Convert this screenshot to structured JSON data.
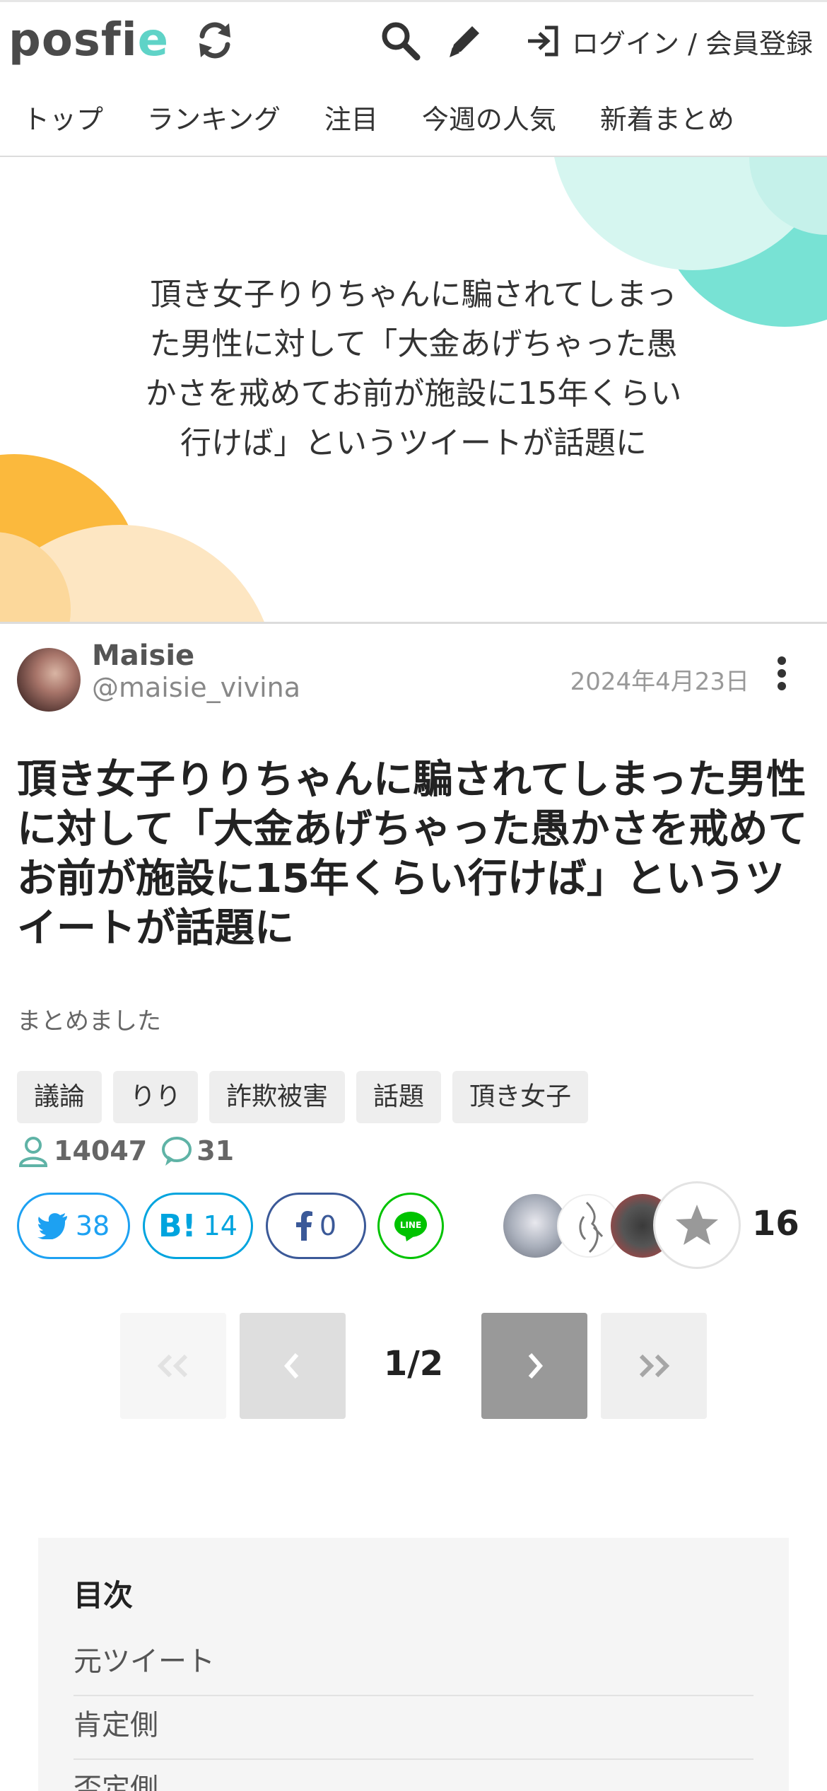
{
  "header": {
    "logo_main": "posfi",
    "logo_accent": "e",
    "login_label": "ログイン / 会員登録"
  },
  "nav": {
    "items": [
      "トップ",
      "ランキング",
      "注目",
      "今週の人気",
      "新着まとめ"
    ]
  },
  "hero": {
    "title": "頂き女子りりちゃんに騙されてしまった男性に対して「大金あげちゃった愚かさを戒めてお前が施設に15年くらい行けば」というツイートが話題に"
  },
  "author": {
    "name": "Maisie",
    "handle": "@maisie_vivina",
    "date": "2024年4月23日"
  },
  "article": {
    "title": "頂き女子りりちゃんに騙されてしまった男性に対して「大金あげちゃった愚かさを戒めてお前が施設に15年くらい行けば」というツイートが話題に",
    "summary": "まとめました",
    "tags": [
      "議論",
      "りり",
      "詐欺被害",
      "話題",
      "頂き女子"
    ],
    "views": "14047",
    "comments": "31"
  },
  "share": {
    "twitter_count": "38",
    "hatena_label": "B!",
    "hatena_count": "14",
    "facebook_count": "0",
    "line_label": "LINE",
    "favorites_count": "16"
  },
  "pager": {
    "current": "1/2"
  },
  "toc": {
    "title": "目次",
    "items": [
      "元ツイート",
      "肯定側",
      "否定側"
    ]
  },
  "colors": {
    "accent": "#5fd3c7",
    "twitter": "#1da1f2",
    "hatena": "#00a4de",
    "facebook": "#3b5998",
    "line": "#00c300"
  }
}
